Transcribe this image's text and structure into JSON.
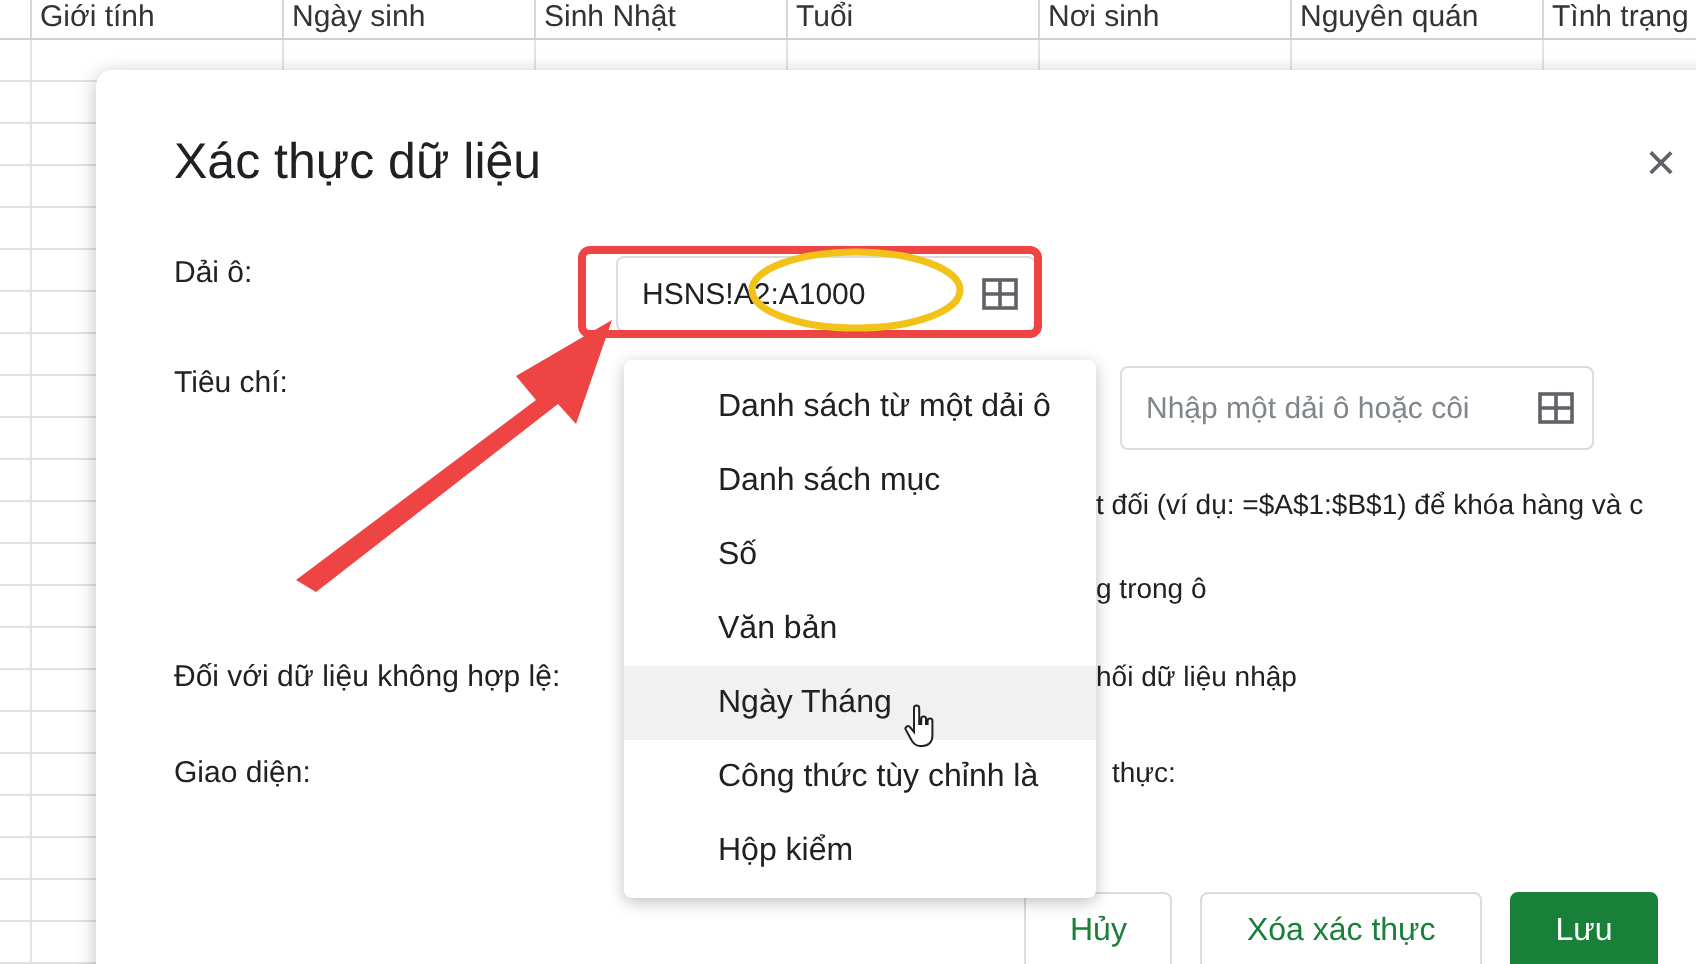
{
  "sheet": {
    "columns": [
      "Giới tính",
      "Ngày sinh",
      "Sinh Nhật",
      "Tuổi",
      "Nơi sinh",
      "Nguyên quán",
      "Tình trạng"
    ]
  },
  "dialog": {
    "title": "Xác thực dữ liệu",
    "close": "×",
    "range": {
      "label": "Dải ô:",
      "value": "HSNS!A2:A1000"
    },
    "criteria": {
      "label": "Tiêu chí:",
      "placeholder": "Nhập một dải ô hoặc côi"
    },
    "hint": "t đối (ví dụ: =$A$1:$B$1) để khóa hàng và c",
    "cell_option": "g trong ô",
    "invalid": {
      "label": "Đối với dữ liệu không hợp lệ:",
      "option": "hối dữ liệu nhập"
    },
    "appearance": {
      "label": "Giao diện:",
      "option": "thực:"
    },
    "buttons": [
      {
        "label": "Hủy",
        "kind": "outline"
      },
      {
        "label": "Xóa xác thực",
        "kind": "outline"
      },
      {
        "label": "Lưu",
        "kind": "primary"
      }
    ]
  },
  "menu": {
    "items": [
      {
        "label": "Danh sách từ một dải ô",
        "highlighted": false
      },
      {
        "label": "Danh sách mục",
        "highlighted": false
      },
      {
        "label": "Số",
        "highlighted": false
      },
      {
        "label": "Văn bản",
        "highlighted": false
      },
      {
        "label": "Ngày Tháng",
        "highlighted": true
      },
      {
        "label": "Công thức tùy chỉnh là",
        "highlighted": false
      },
      {
        "label": "Hộp kiểm",
        "highlighted": false
      }
    ]
  }
}
